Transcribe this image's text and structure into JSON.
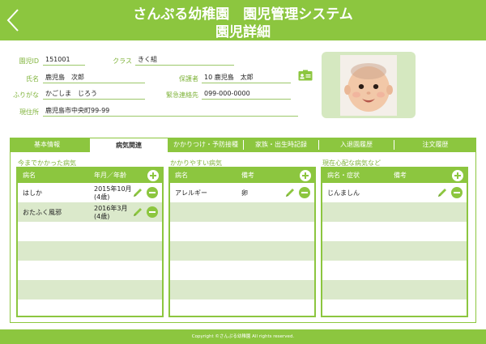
{
  "header": {
    "title": "さんぷる幼稚園　園児管理システム",
    "subtitle": "園児詳細"
  },
  "info": {
    "id_label": "園児ID",
    "id_value": "151001",
    "class_label": "クラス",
    "class_value": "きく組",
    "name_label": "氏名",
    "name_value": "鹿児島　次郎",
    "guardian_label": "保護者",
    "guardian_value": "10 鹿児島　太郎",
    "kana_label": "ふりがな",
    "kana_value": "かごしま　じろう",
    "emergency_label": "緊急連絡先",
    "emergency_value": "099-000-0000",
    "address_label": "現住所",
    "address_value": "鹿児島市中央町99-99"
  },
  "tabs": [
    {
      "label": "基本情報"
    },
    {
      "label": "病気関連"
    },
    {
      "label": "かかりつけ・予防接種"
    },
    {
      "label": "家族・出生時記録"
    },
    {
      "label": "入退園履歴"
    },
    {
      "label": "注文履歴"
    }
  ],
  "active_tab": 1,
  "panels": {
    "past": {
      "title": "今までかかった病気",
      "col1": "病名",
      "col2": "年月／年齢",
      "rows": [
        {
          "name": "はしか",
          "date": "2015年10月",
          "age": "(4歳)"
        },
        {
          "name": "おたふく風邪",
          "date": "2016年3月",
          "age": "(4歳)"
        }
      ]
    },
    "prone": {
      "title": "かかりやすい病気",
      "col1": "病名",
      "col2": "備考",
      "rows": [
        {
          "name": "アレルギー",
          "note": "卵"
        }
      ]
    },
    "concern": {
      "title": "現在心配な病気など",
      "col1": "病名・症状",
      "col2": "備考",
      "rows": [
        {
          "name": "じんましん",
          "note": ""
        }
      ]
    }
  },
  "footer": {
    "copyright": "Copyright ©さんぷる幼稚園 All rights reserved."
  },
  "colors": {
    "accent": "#8cc63f",
    "row_alt": "#dbe9cb",
    "label": "#7fb33a"
  }
}
